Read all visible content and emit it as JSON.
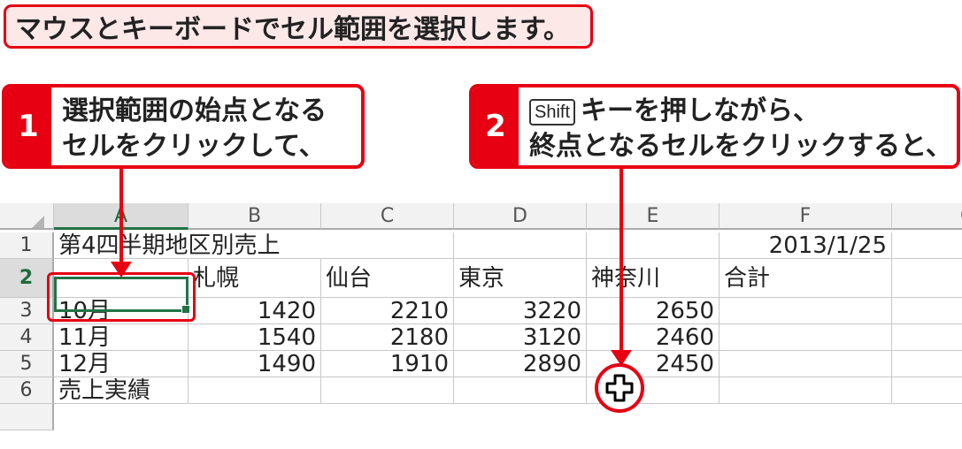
{
  "banner": {
    "text": "マウスとキーボードでセル範囲を選択します。"
  },
  "callouts": [
    {
      "number": "1",
      "line1": "選択範囲の始点となる",
      "line2": "セルをクリックして、"
    },
    {
      "number": "2",
      "key": "Shift",
      "line1_after_key": "キーを押しながら、",
      "line2": "終点となるセルをクリックすると、"
    }
  ],
  "sheet": {
    "columns": [
      "A",
      "B",
      "C",
      "D",
      "E",
      "F",
      "G"
    ],
    "rows": [
      {
        "num": "1",
        "cells": [
          "第4四半期地区別売上",
          "",
          "",
          "",
          "",
          "2013/1/25"
        ]
      },
      {
        "num": "2",
        "cells": [
          "",
          "札幌",
          "仙台",
          "東京",
          "神奈川",
          "合計"
        ]
      },
      {
        "num": "3",
        "cells": [
          "10月",
          "1420",
          "2210",
          "3220",
          "2650",
          ""
        ]
      },
      {
        "num": "4",
        "cells": [
          "11月",
          "1540",
          "2180",
          "3120",
          "2460",
          ""
        ]
      },
      {
        "num": "5",
        "cells": [
          "12月",
          "1490",
          "1910",
          "2890",
          "2450",
          ""
        ]
      },
      {
        "num": "6",
        "cells": [
          "売上実績",
          "",
          "",
          "",
          "",
          ""
        ]
      }
    ],
    "active_cell": "A2"
  },
  "colors": {
    "accent_red": "#e60012",
    "excel_green": "#217346"
  }
}
